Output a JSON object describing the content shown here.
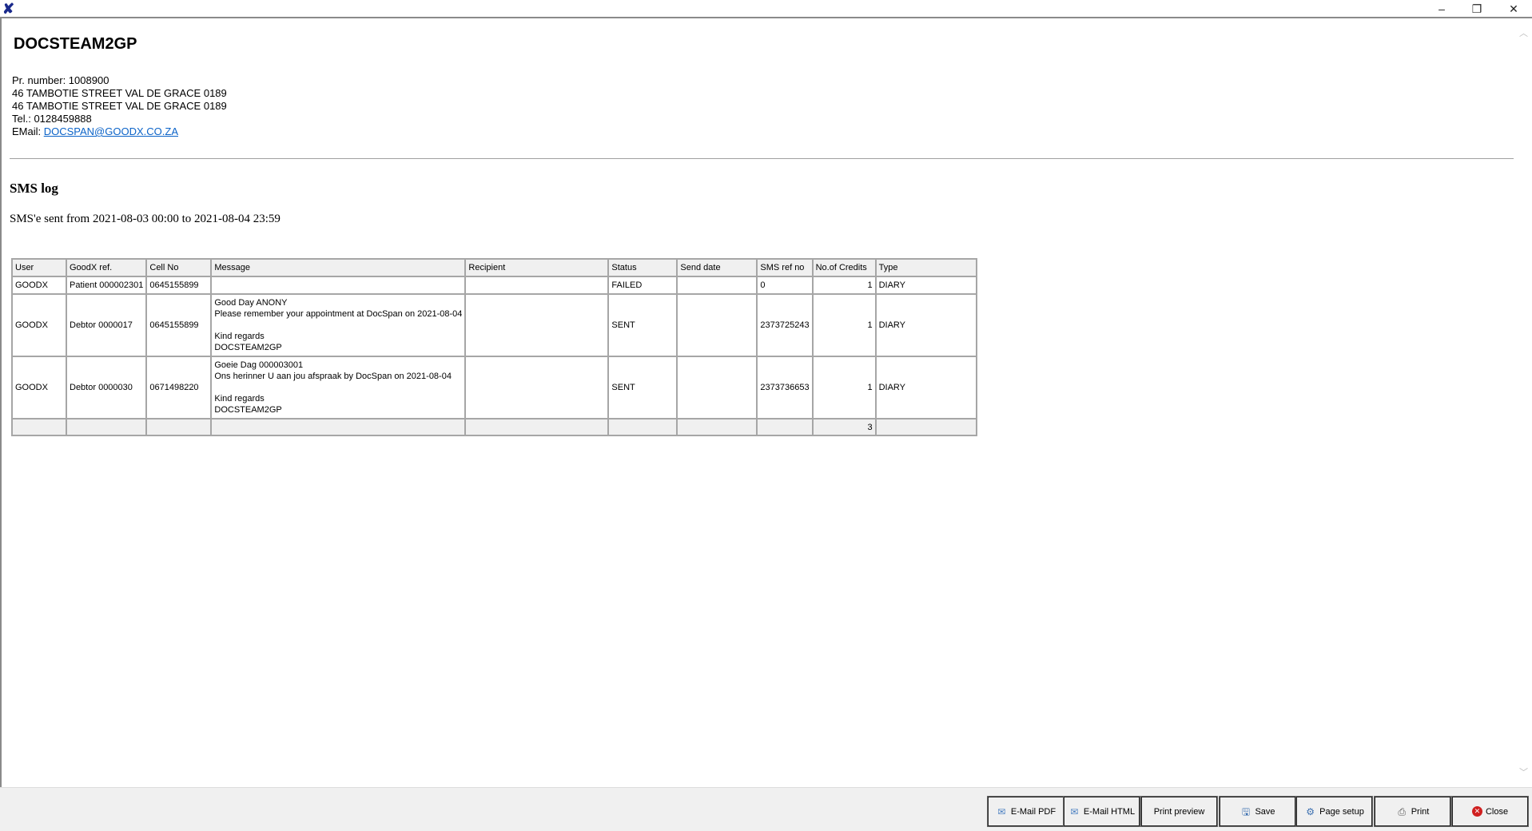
{
  "window": {
    "minimize": "–",
    "restore": "❐",
    "close": "✕"
  },
  "header": {
    "org": "DOCSTEAM2GP",
    "pr_number": "Pr. number: 1008900",
    "address1": "46 TAMBOTIE STREET VAL DE GRACE 0189",
    "address2": "46 TAMBOTIE STREET VAL DE GRACE 0189",
    "tel": "Tel.: 0128459888",
    "email_label": "EMail: ",
    "email": "DOCSPAN@GOODX.CO.ZA"
  },
  "report": {
    "title": "SMS log",
    "range": "SMS'e sent from 2021-08-03 00:00 to 2021-08-04 23:59"
  },
  "table": {
    "columns": [
      "User",
      "GoodX ref.",
      "Cell No",
      "Message",
      "Recipient",
      "Status",
      "Send date",
      "SMS ref no",
      "No.of Credits",
      "Type"
    ],
    "rows": [
      {
        "user": "GOODX",
        "ref": "Patient 000002301",
        "cell": "0645155899",
        "message": [],
        "recipient": "",
        "status": "FAILED",
        "send_date": "",
        "sms_ref": "0",
        "credits": "1",
        "type": "DIARY"
      },
      {
        "user": "GOODX",
        "ref": "Debtor 0000017",
        "cell": "0645155899",
        "message": [
          "Good Day ANONY",
          "Please remember your appointment at DocSpan on 2021-08-04",
          "",
          "Kind regards",
          "DOCSTEAM2GP"
        ],
        "recipient": "",
        "status": "SENT",
        "send_date": "",
        "sms_ref": "2373725243",
        "credits": "1",
        "type": "DIARY"
      },
      {
        "user": "GOODX",
        "ref": "Debtor 0000030",
        "cell": "0671498220",
        "message": [
          "Goeie Dag 000003001",
          "Ons herinner U aan jou afspraak by DocSpan on 2021-08-04",
          "",
          "Kind regards",
          "DOCSTEAM2GP"
        ],
        "recipient": "",
        "status": "SENT",
        "send_date": "",
        "sms_ref": "2373736653",
        "credits": "1",
        "type": "DIARY"
      }
    ],
    "total_credits": "3"
  },
  "toolbar": {
    "email_pdf": "E-Mail PDF",
    "email_html": "E-Mail HTML",
    "print_preview": "Print preview",
    "save": "Save",
    "page_setup": "Page setup",
    "print": "Print",
    "close": "Close"
  }
}
